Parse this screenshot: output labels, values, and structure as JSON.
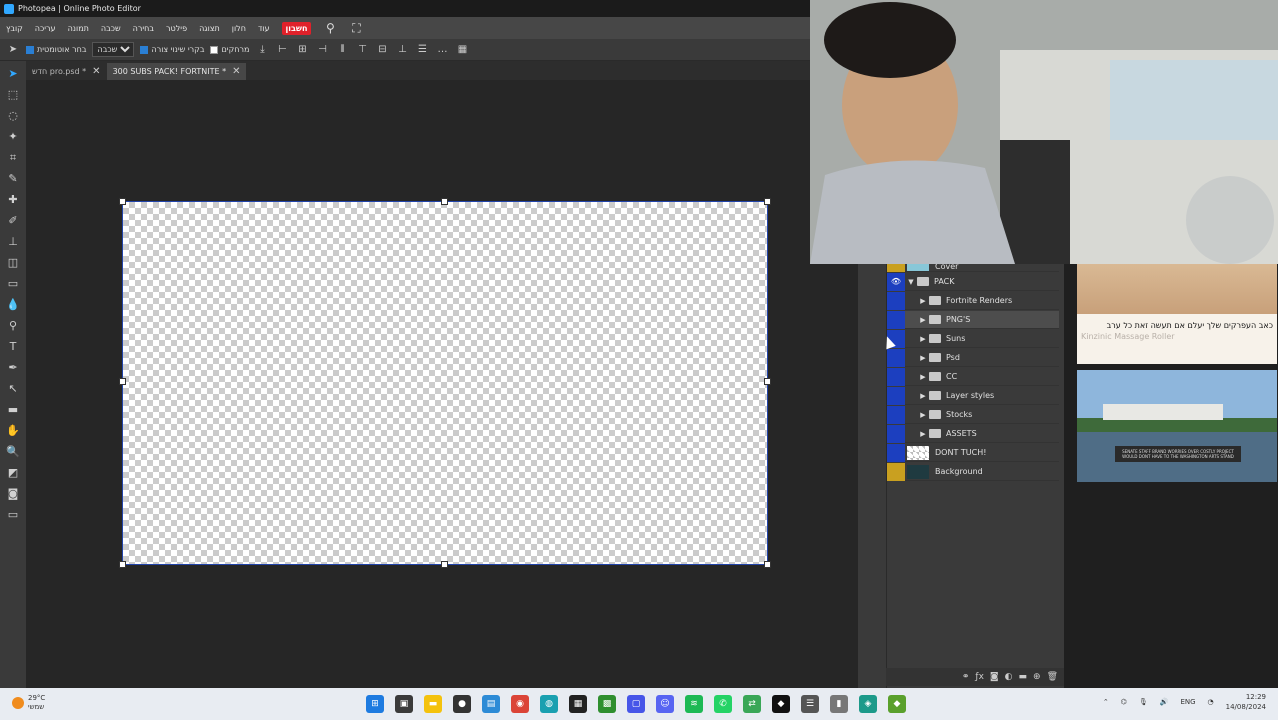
{
  "window": {
    "title": "Photopea | Online Photo Editor"
  },
  "menu": {
    "items": [
      "קובץ",
      "עריכה",
      "תמונה",
      "שכבה",
      "בחירה",
      "פילטר",
      "תצוגה",
      "חלון",
      "עוד"
    ],
    "highlight": "חשבון"
  },
  "options": {
    "auto_select_label": "בחר אוטומטית",
    "auto_select_checked": true,
    "target_value": "שכבה",
    "transform_controls_label": "בקרי שינוי צורה",
    "transform_controls_checked": true,
    "distances_label": "מרחקים",
    "distances_checked": false
  },
  "tabs": [
    {
      "label": "חדש pro.psd *",
      "active": false
    },
    {
      "label": "300 SUBS PACK! FORTNITE *",
      "active": true
    }
  ],
  "layers": [
    {
      "name": "Cover",
      "type": "layer",
      "indent": 0,
      "partial": true
    },
    {
      "name": "PACK",
      "type": "folder",
      "indent": 0,
      "expanded": true,
      "visible": true
    },
    {
      "name": "Fortnite Renders",
      "type": "folder",
      "indent": 1
    },
    {
      "name": "PNG'S",
      "type": "folder",
      "indent": 1,
      "selected": true
    },
    {
      "name": "Suns",
      "type": "folder",
      "indent": 1
    },
    {
      "name": "Psd",
      "type": "folder",
      "indent": 1
    },
    {
      "name": "CC",
      "type": "folder",
      "indent": 1
    },
    {
      "name": "Layer styles",
      "type": "folder",
      "indent": 1
    },
    {
      "name": "Stocks",
      "type": "folder",
      "indent": 1
    },
    {
      "name": "ASSETS",
      "type": "folder",
      "indent": 1
    },
    {
      "name": "DONT TUCH!",
      "type": "layer",
      "indent": 0
    },
    {
      "name": "Background",
      "type": "layer",
      "indent": 0
    }
  ],
  "ads": {
    "ad1_text": "כאב העפרקים שלך יעלם אם תעשה זאת כל ערב",
    "ad1_source": "Kinzinic Massage Roller",
    "ad2_caption": "SENATE STAFF BRAND WORRIES OVER COSTLY PROJECT WOULD DONT HAVE TO THE WASHINGTON ARTS STAND"
  },
  "taskbar": {
    "weather_temp": "29°C",
    "weather_desc": "שמשי",
    "lang": "ENG",
    "time": "12:29",
    "date": "14/08/2024"
  },
  "colors": {
    "accent": "#31a8ff",
    "highlight_menu": "#e0212a",
    "layer_vis": "#1c3fbf",
    "canvas_border": "#2244aa"
  }
}
